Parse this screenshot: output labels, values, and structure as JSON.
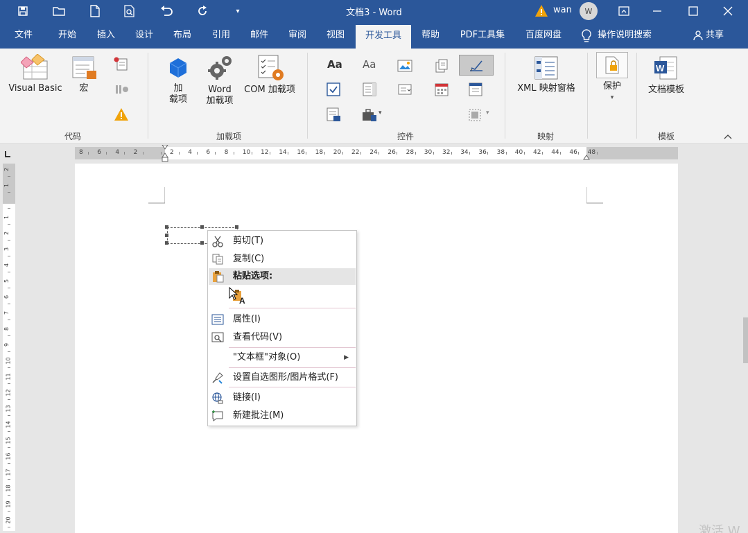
{
  "titlebar": {
    "title": "文档3  -  Word",
    "user": "wan",
    "avatar_initial": "W"
  },
  "tabs": [
    {
      "label": "文件"
    },
    {
      "label": "开始"
    },
    {
      "label": "插入"
    },
    {
      "label": "设计"
    },
    {
      "label": "布局"
    },
    {
      "label": "引用"
    },
    {
      "label": "邮件"
    },
    {
      "label": "审阅"
    },
    {
      "label": "视图"
    },
    {
      "label": "开发工具",
      "active": true
    },
    {
      "label": "帮助"
    },
    {
      "label": "PDF工具集"
    },
    {
      "label": "百度网盘"
    },
    {
      "label": "操作说明搜索"
    }
  ],
  "share_label": "共享",
  "ribbon": {
    "groups": {
      "code": "代码",
      "addins": "加载项",
      "controls": "控件",
      "mapping": "映射",
      "protect": "",
      "templates": "模板"
    },
    "buttons": {
      "visual_basic": "Visual Basic",
      "macro": "宏",
      "addin_line1": "加",
      "addin_line2": "载项",
      "word_addin_line1": "Word",
      "word_addin_line2": "加载项",
      "com_addin": "COM 加载项",
      "xml_mapping": "XML 映射窗格",
      "protect": "保护",
      "doc_template": "文档模板"
    }
  },
  "hruler_labels": [
    "8",
    "6",
    "4",
    "2",
    "",
    "2",
    "4",
    "6",
    "8",
    "10",
    "12",
    "14",
    "16",
    "18",
    "20",
    "22",
    "24",
    "26",
    "28",
    "30",
    "32",
    "34",
    "36",
    "38",
    "40",
    "42",
    "44",
    "46",
    "48"
  ],
  "vruler_labels": [
    "2",
    "1",
    "",
    "1",
    "2",
    "3",
    "4",
    "5",
    "6",
    "7",
    "8",
    "9",
    "10",
    "11",
    "12",
    "13",
    "14",
    "15",
    "16",
    "17",
    "18",
    "19",
    "20"
  ],
  "context_menu": {
    "cut": "剪切(T)",
    "copy": "复制(C)",
    "paste_options": "粘贴选项:",
    "properties": "属性(I)",
    "view_code": "查看代码(V)",
    "textbox_object": "\"文本框\"对象(O)",
    "format_shape": "设置自选图形/图片格式(F)",
    "link": "链接(I)",
    "new_comment": "新建批注(M)"
  },
  "watermark": "激活 W",
  "colors": {
    "brand": "#2b579a",
    "ribbon_bg": "#f3f3f3",
    "warning": "#f0a30a",
    "accent_orange": "#e07b22",
    "accent_blue": "#1e6fd9"
  }
}
